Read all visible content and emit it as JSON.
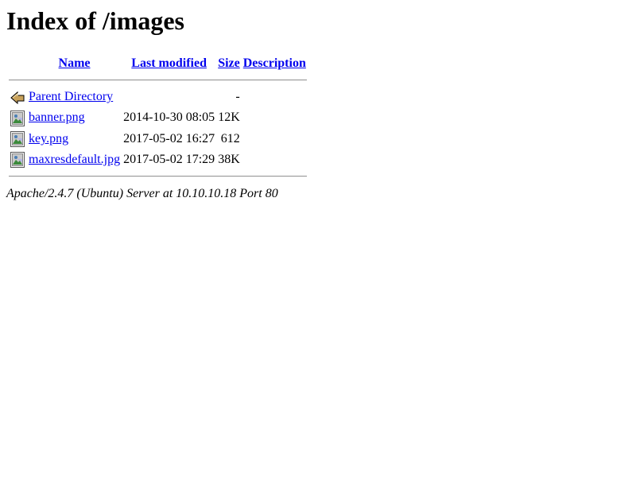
{
  "page": {
    "title": "Index of /images"
  },
  "table": {
    "headers": {
      "name": "Name",
      "last_modified": "Last modified",
      "size": "Size",
      "description": "Description"
    },
    "parent": {
      "icon": "back-icon",
      "label": "Parent Directory",
      "size": "-"
    },
    "rows": [
      {
        "icon": "image-icon",
        "name": "banner.png",
        "modified": "2014-10-30 08:05",
        "size": "12K",
        "description": ""
      },
      {
        "icon": "image-icon",
        "name": "key.png",
        "modified": "2017-05-02 16:27",
        "size": "612",
        "description": ""
      },
      {
        "icon": "image-icon",
        "name": "maxresdefault.jpg",
        "modified": "2017-05-02 17:29",
        "size": "38K",
        "description": ""
      }
    ]
  },
  "footer": {
    "address": "Apache/2.4.7 (Ubuntu) Server at 10.10.10.18 Port 80"
  },
  "colors": {
    "link": "#0000ee",
    "text": "#000000",
    "background": "#ffffff"
  }
}
